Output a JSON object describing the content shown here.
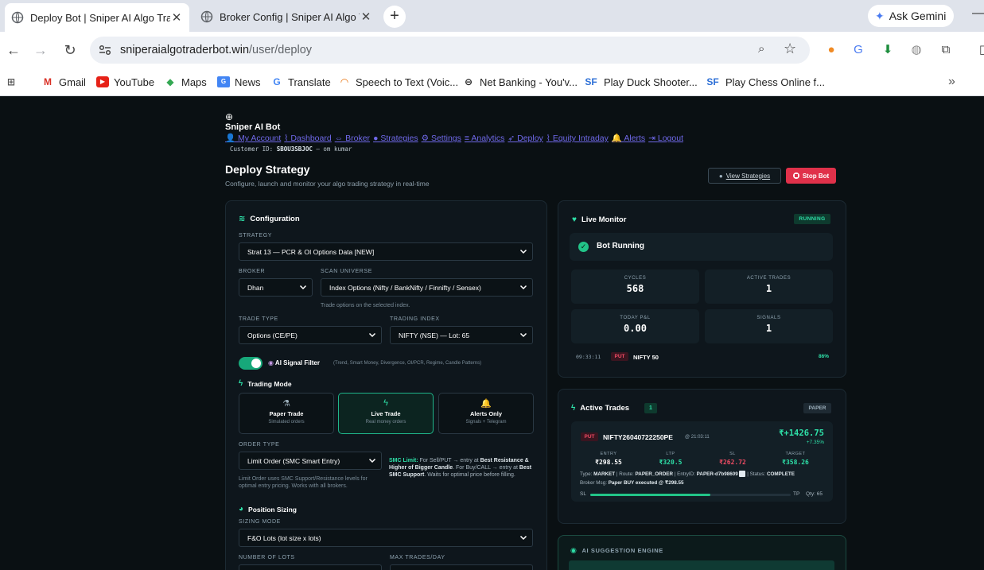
{
  "browser": {
    "tabs": [
      {
        "title": "Deploy Bot | Sniper AI Algo Trac",
        "active": true
      },
      {
        "title": "Broker Config | Sniper AI Algo T",
        "active": false
      }
    ],
    "new_tab": "+",
    "ask_gemini": "Ask Gemini",
    "url_host": "sniperaialgotraderbot.win",
    "url_path": "/user/deploy",
    "bookmarks": [
      "Gmail",
      "YouTube",
      "Maps",
      "News",
      "Translate",
      "Speech to Text (Voic...",
      "Net Banking - You'v...",
      "Play Duck Shooter...",
      "Play Chess Online f..."
    ]
  },
  "header": {
    "brand": "Sniper AI Bot",
    "nav": [
      "My Account",
      "Dashboard",
      "Broker",
      "Strategies",
      "Settings",
      "Analytics",
      "Deploy",
      "Equity Intraday",
      "Alerts",
      "Logout"
    ],
    "customer_label": "Customer ID:",
    "customer_id": "SBOU3SBJOC",
    "customer_name": "— om kumar"
  },
  "page": {
    "title": "Deploy Strategy",
    "subtitle": "Configure, launch and monitor your algo trading strategy in real-time",
    "view_strategies": "View Strategies",
    "stop_bot": "Stop Bot"
  },
  "config": {
    "title": "Configuration",
    "strategy_label": "STRATEGY",
    "strategy_value": "Strat 13 — PCR & OI Options Data [NEW]",
    "broker_label": "BROKER",
    "broker_value": "Dhan",
    "scan_label": "SCAN UNIVERSE",
    "scan_value": "Index Options (Nifty / BankNifty / Finnifty / Sensex)",
    "scan_hint": "Trade options on the selected index.",
    "trade_type_label": "TRADE TYPE",
    "trade_type_value": "Options (CE/PE)",
    "trading_index_label": "TRADING INDEX",
    "trading_index_value": "NIFTY (NSE) — Lot: 65",
    "ai_filter_enabled": true,
    "ai_filter_label": "AI Signal Filter",
    "ai_filter_hint": "(Trend, Smart Money, Divergence, OI/PCR, Regime, Candle Patterns)",
    "trading_mode_title": "Trading Mode",
    "modes": [
      {
        "title": "Paper Trade",
        "sub": "Simulated orders",
        "icon": "flask-icon",
        "selected": false
      },
      {
        "title": "Live Trade",
        "sub": "Real money orders",
        "icon": "bolt-icon",
        "selected": true
      },
      {
        "title": "Alerts Only",
        "sub": "Signals + Telegram",
        "icon": "bell-icon",
        "selected": false
      }
    ],
    "order_type_label": "ORDER TYPE",
    "order_type_value": "Limit Order (SMC Smart Entry)",
    "order_hint": "Limit Order uses SMC Support/Resistance levels for optimal entry pricing. Works with all brokers.",
    "smc_label": "SMC Limit:",
    "smc_text_1": "For Sell/PUT → entry at",
    "smc_bold_1": "Best Resistance & Higher of Bigger Candle",
    "smc_text_2": ". For Buy/CALL → entry at",
    "smc_bold_2": "Best SMC Support",
    "smc_text_3": ". Waits for optimal price before filling.",
    "position_title": "Position Sizing",
    "sizing_mode_label": "SIZING MODE",
    "sizing_mode_value": "F&O Lots (lot size x lots)",
    "lots_label": "NUMBER OF LOTS",
    "max_trades_label": "MAX TRADES/DAY"
  },
  "monitor": {
    "title": "Live Monitor",
    "status_badge": "RUNNING",
    "bot_status": "Bot Running",
    "stats": [
      {
        "label": "CYCLES",
        "value": "568"
      },
      {
        "label": "ACTIVE TRADES",
        "value": "1"
      },
      {
        "label": "TODAY P&L",
        "value": "0.00"
      },
      {
        "label": "SIGNALS",
        "value": "1"
      }
    ],
    "signal": {
      "time": "09:33:11",
      "side": "PUT",
      "symbol": "NIFTY 50",
      "confidence": "86%"
    }
  },
  "trades": {
    "title": "Active Trades",
    "count": "1",
    "mode_badge": "PAPER",
    "trade": {
      "side": "PUT",
      "symbol": "NIFTY26040722250PE",
      "time": "@ 21:03:11",
      "pnl": "₹+1426.75",
      "pnl_pct": "+7.35%",
      "cols": [
        {
          "label": "ENTRY",
          "value": "₹298.55",
          "color": "#ffffff"
        },
        {
          "label": "LTP",
          "value": "₹320.5",
          "color": "#2ee0a8"
        },
        {
          "label": "SL",
          "value": "₹262.72",
          "color": "#f04c64"
        },
        {
          "label": "TARGET",
          "value": "₹358.26",
          "color": "#2ee0a8"
        }
      ],
      "type_label": "Type:",
      "type_value": "MARKET",
      "route_label": "| Route:",
      "route_value": "PAPER_ORDER",
      "entry_id_label": "| EntryID:",
      "entry_id_value": "PAPER-d7b98609",
      "status_label": "| Status:",
      "status_value": "COMPLETE",
      "broker_msg_label": "Broker Msg:",
      "broker_msg_value": "Paper BUY executed @ ₹298.55",
      "progress": 0.6,
      "sl_label": "SL",
      "tp_label": "TP",
      "qty": "Qty: 65"
    }
  },
  "ai_suggestion": {
    "title": "AI SUGGESTION ENGINE"
  }
}
